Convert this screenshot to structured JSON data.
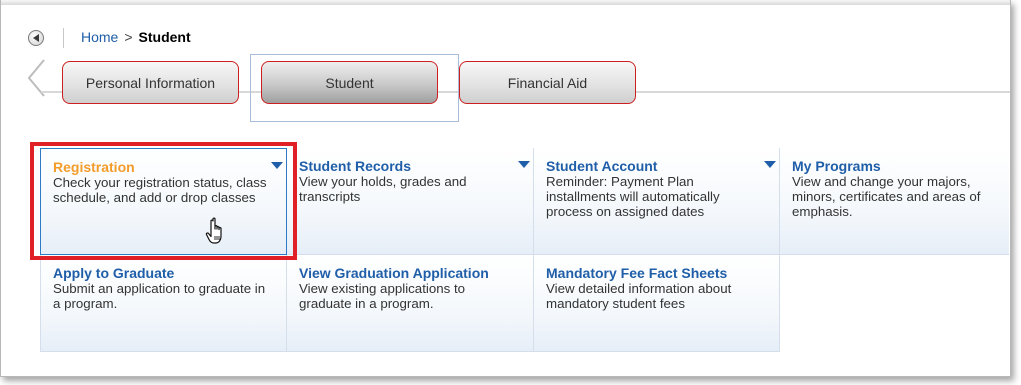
{
  "breadcrumb": {
    "home": "Home",
    "separator": ">",
    "current": "Student"
  },
  "tabs": [
    {
      "label": "Personal Information",
      "active": false
    },
    {
      "label": "Student",
      "active": true
    },
    {
      "label": "Financial Aid",
      "active": false
    }
  ],
  "tiles": [
    {
      "title": "Registration",
      "description": "Check your registration status, class schedule, and add or drop classes",
      "has_dropdown": true,
      "highlighted": true
    },
    {
      "title": "Student Records",
      "description": "View your holds, grades and transcripts",
      "has_dropdown": true
    },
    {
      "title": "Student Account",
      "description": "Reminder: Payment Plan installments will automatically process on assigned dates",
      "has_dropdown": true
    },
    {
      "title": "My Programs",
      "description": "View and change your majors, minors, certificates and areas of emphasis.",
      "has_dropdown": false
    },
    {
      "title": "Apply to Graduate",
      "description": "Submit an application to graduate in a program.",
      "has_dropdown": false
    },
    {
      "title": "View Graduation Application",
      "description": "View existing applications to graduate in a program.",
      "has_dropdown": false
    },
    {
      "title": "Mandatory Fee Fact Sheets",
      "description": "View detailed information about mandatory student fees",
      "has_dropdown": false
    }
  ],
  "colors": {
    "link_blue": "#1f5ea8",
    "active_orange": "#f39c2a",
    "highlight_red": "#e01f26",
    "tab_border_red": "#cc1f1f"
  },
  "icons": {
    "back": "back-arrow-icon",
    "dropdown": "chevron-down-icon",
    "cursor": "hand-pointer-icon"
  }
}
